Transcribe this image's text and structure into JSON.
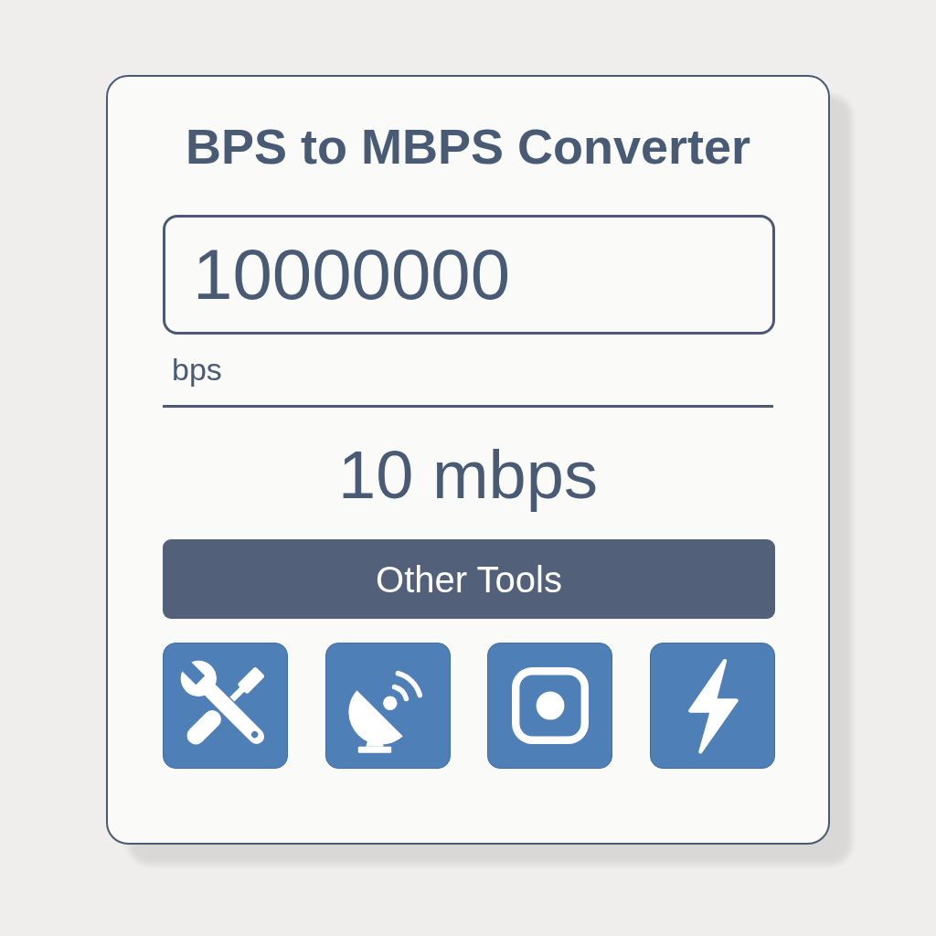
{
  "title": "BPS to MBPS Converter",
  "input": {
    "value": "10000000",
    "unit": "bps"
  },
  "result": "10 mbps",
  "other_tools": {
    "label": "Other Tools"
  }
}
